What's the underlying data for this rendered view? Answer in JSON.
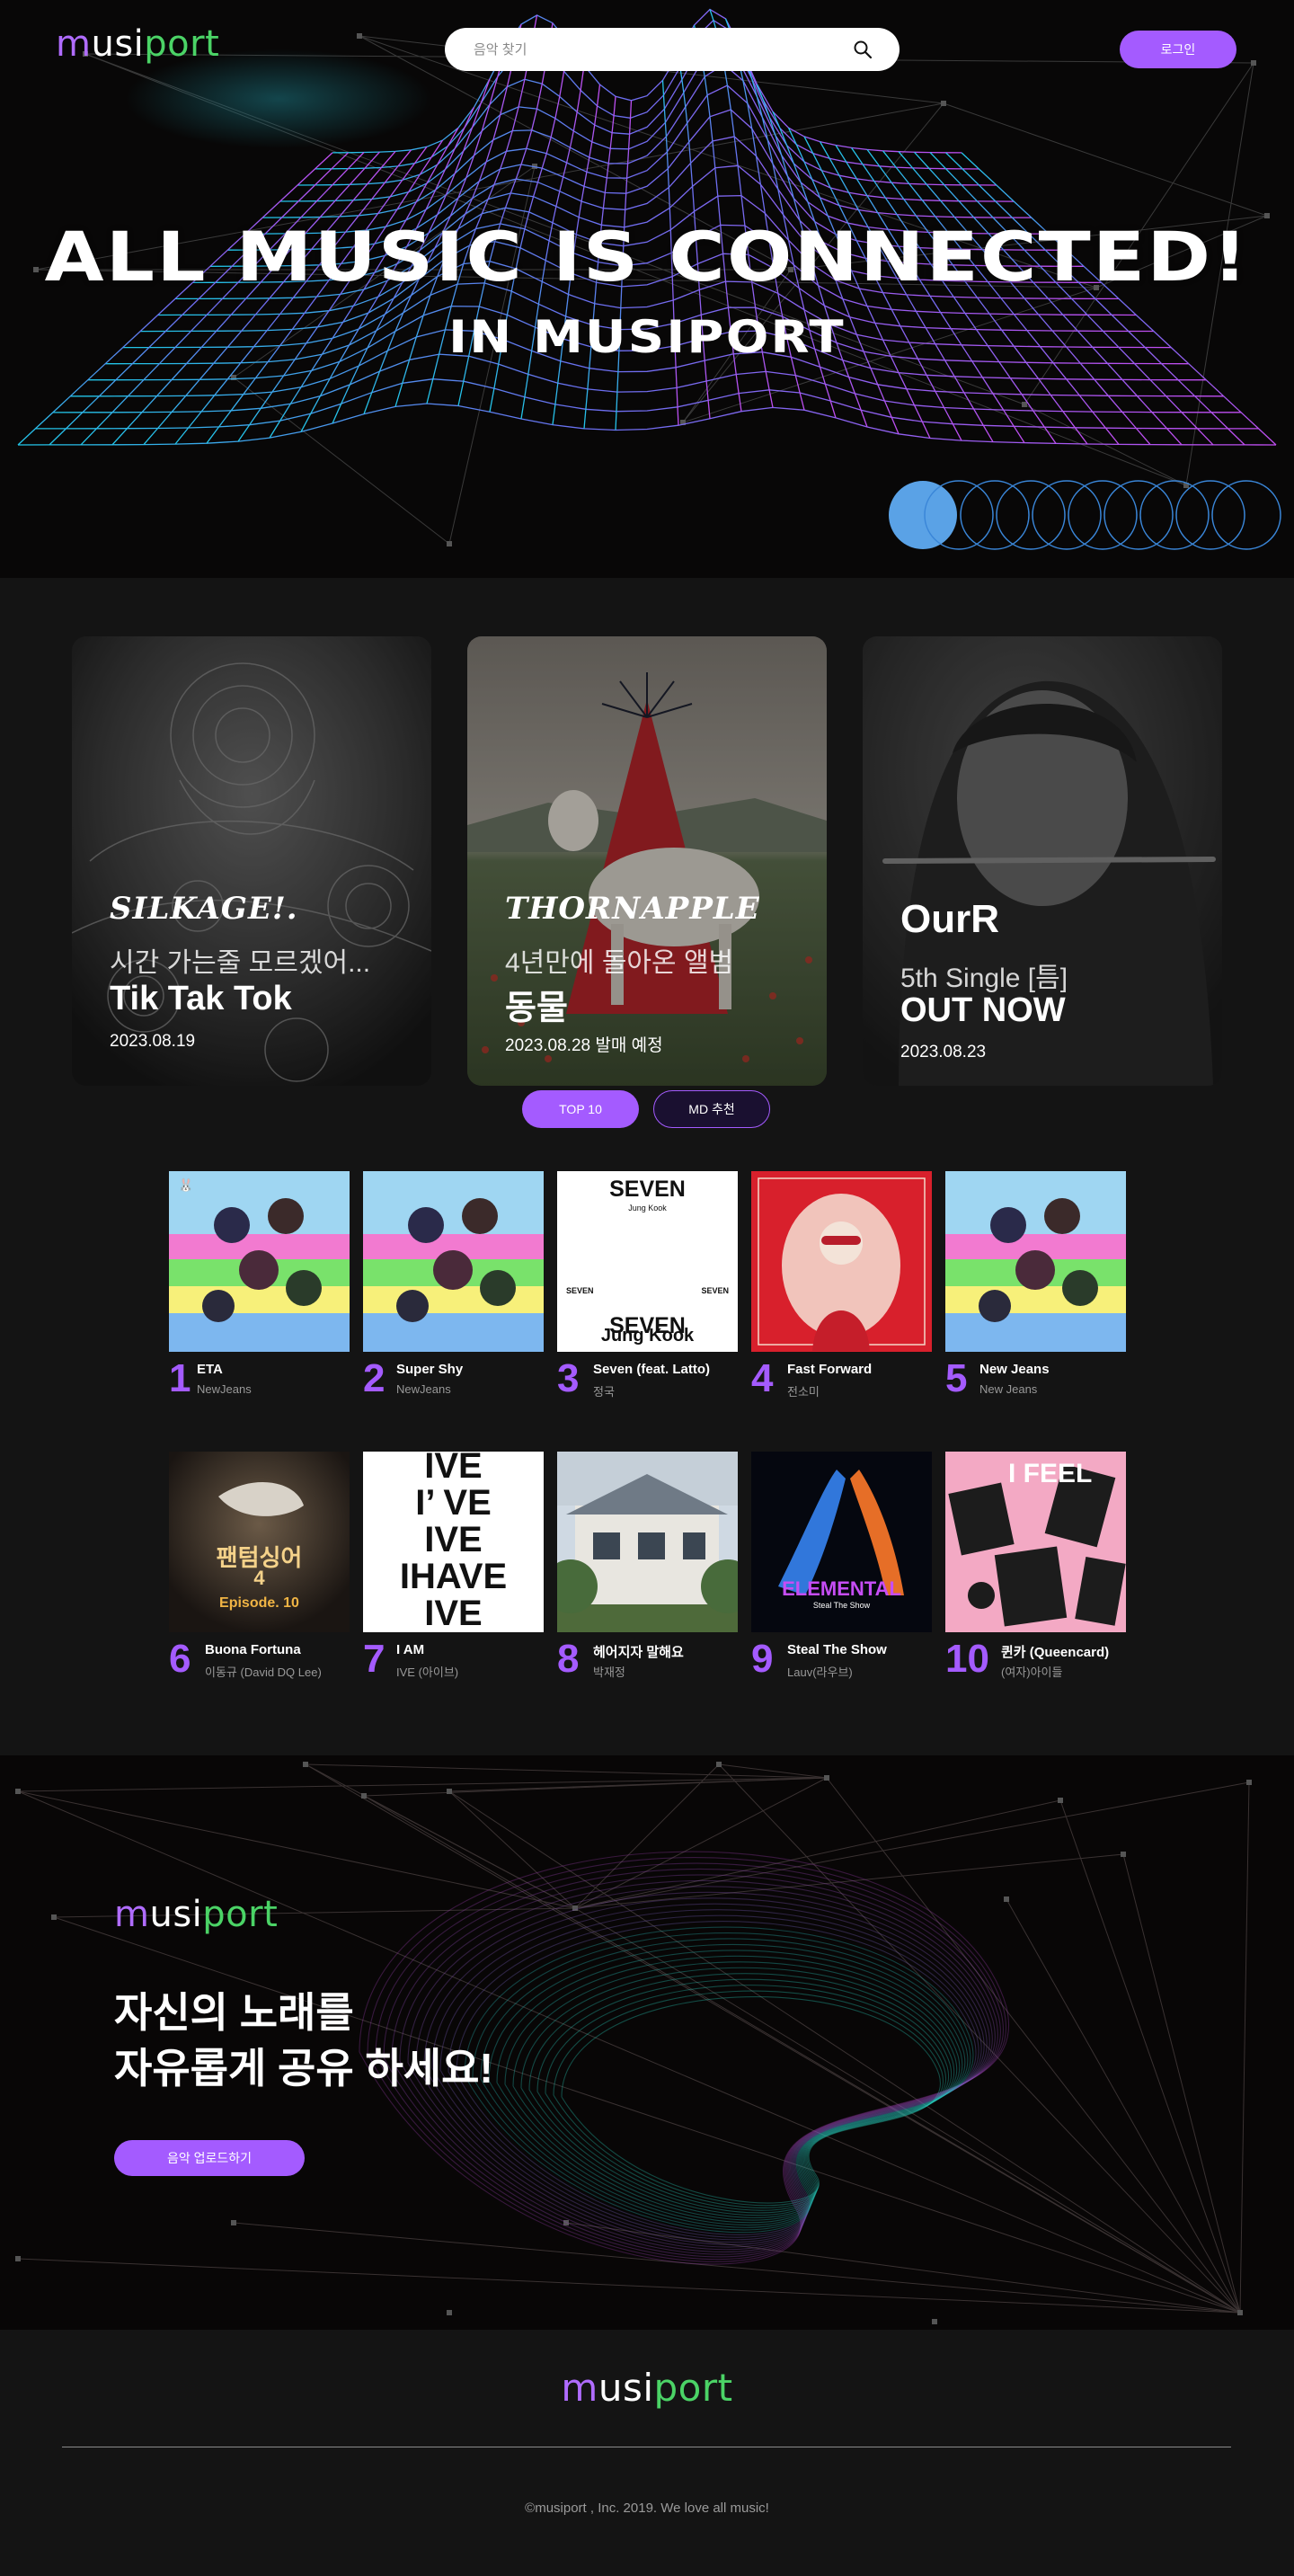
{
  "header": {
    "logo": {
      "part1": "m",
      "part2": "usi",
      "part3": "port"
    },
    "search": {
      "placeholder": "음악 찾기",
      "icon": "search-icon"
    },
    "login_label": "로그인"
  },
  "hero": {
    "title": "ALL MUSIC IS CONNECTED!",
    "subtitle": "IN MUSIPORT"
  },
  "featured": [
    {
      "brand": "SILKAGE!.",
      "line1": "시간 가는줄 모르겠어...",
      "line2": "Tik Tak Tok",
      "date": "2023.08.19"
    },
    {
      "brand": "THORNAPPLE",
      "line1": "4년만에 돌아온 앨범",
      "line2": "동물",
      "date": "2023.08.28 발매 예정"
    },
    {
      "brand": "OurR",
      "line1": "5th Single [틈]",
      "line2": "OUT NOW",
      "date": "2023.08.23"
    }
  ],
  "tabs": {
    "top10": "TOP 10",
    "md": "MD 추천"
  },
  "chart": [
    {
      "rank": "1",
      "title": "ETA",
      "artist": "NewJeans"
    },
    {
      "rank": "2",
      "title": "Super Shy",
      "artist": "NewJeans"
    },
    {
      "rank": "3",
      "title": "Seven (feat. Latto)",
      "artist": "정국"
    },
    {
      "rank": "4",
      "title": "Fast Forward",
      "artist": "전소미"
    },
    {
      "rank": "5",
      "title": "New Jeans",
      "artist": "New Jeans"
    },
    {
      "rank": "6",
      "title": "Buona Fortuna",
      "artist": "이동규 (David DQ Lee)"
    },
    {
      "rank": "7",
      "title": "I AM",
      "artist": "IVE (아이브)"
    },
    {
      "rank": "8",
      "title": "헤어지자 말해요",
      "artist": "박재정"
    },
    {
      "rank": "9",
      "title": "Steal The Show",
      "artist": "Lauv(라우브)"
    },
    {
      "rank": "10",
      "title": "퀸카 (Queencard)",
      "artist": "(여자)아이들"
    }
  ],
  "covers": {
    "seven_top": "SEVEN",
    "seven_sub": "Jung Kook",
    "seven_mid_left": "SEVEN",
    "seven_mid_right": "SEVEN",
    "seven_bottom": "SEVEN",
    "seven_bottom_sub": "Jung Kook",
    "ive_lines": [
      "IVE",
      "I’  VE",
      "IVE",
      "IHAVE",
      "IVE"
    ],
    "phantom_title": "팬텀싱어",
    "phantom_num": "4",
    "phantom_ep": "Episode. 10",
    "elemental": "ELEMENTAL",
    "elemental_sub": "Steal The Show",
    "queencard_text": "I FEEL"
  },
  "promo": {
    "heading_line1": "자신의 노래를",
    "heading_line2": "자유롭게 공유 하세요!",
    "upload_label": "음악 업로드하기"
  },
  "footer": {
    "copyright": "©musiport , Inc. 2019. We love all music!"
  },
  "colors": {
    "accent": "#a45bff",
    "logo_green": "#4bd366",
    "background": "#141414"
  }
}
